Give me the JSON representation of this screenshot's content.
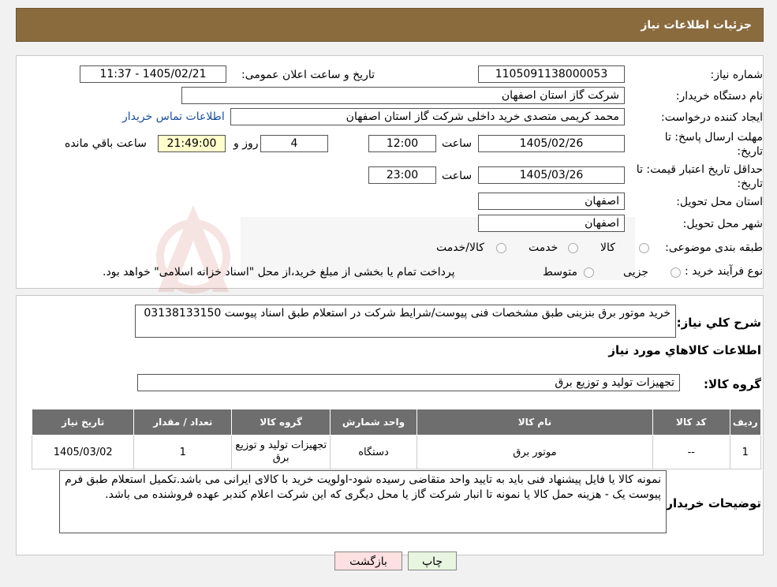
{
  "header": {
    "title": "جزئیات اطلاعات نیاز"
  },
  "form": {
    "need_number_label": "شماره نیاز:",
    "need_number": "1105091138000053",
    "announce_label": "تاریخ و ساعت اعلان عمومی:",
    "announce_value": "1405/02/21 - 11:37",
    "buyer_org_label": "نام دستگاه خریدار:",
    "buyer_org": "شرکت گاز استان اصفهان",
    "creator_label": "ایجاد کننده درخواست:",
    "creator": "محمد کریمی متصدی خرید داخلی شرکت گاز استان اصفهان",
    "contact_link": "اطلاعات تماس خریدار",
    "reply_deadline_label_1": "مهلت ارسال پاسخ: تا",
    "reply_deadline_label_2": "تاریخ:",
    "reply_date": "1405/02/26",
    "time_label": "ساعت",
    "reply_time": "12:00",
    "days_value": "4",
    "days_label": "روز و",
    "remaining_time": "21:49:00",
    "remaining_label": "ساعت باقي مانده",
    "validity_label_1": "حداقل تاریخ اعتبار قیمت: تا",
    "validity_label_2": "تاریخ:",
    "validity_date": "1405/03/26",
    "validity_time": "23:00",
    "province_label": "استان محل تحویل:",
    "province": "اصفهان",
    "city_label": "شهر محل تحویل:",
    "city": "اصفهان",
    "category_label": "طبقه بندی موضوعی:",
    "category_options": [
      "کالا",
      "خدمت",
      "کالا/خدمت"
    ],
    "process_label": "نوع فرآیند خرید :",
    "process_options": [
      "جزیی",
      "متوسط"
    ],
    "process_note": "پرداخت تمام یا بخشی از مبلغ خرید،از محل \"اسناد خزانه اسلامی\" خواهد بود."
  },
  "summary": {
    "desc_label": "شرح کلي نياز:",
    "desc_text": "خرید موتور برق بنزینی  طبق مشخصات فنی پیوست/شرایط شرکت در استعلام طبق اسناد پیوست 03138133150",
    "items_title": "اطلاعات کالاهاي مورد نياز",
    "group_label": "گروه کالا:",
    "group_value": "تجهیزات تولید و توزیع برق"
  },
  "table": {
    "headers": [
      "رديف",
      "کد کالا",
      "نام کالا",
      "واحد شمارش",
      "گروه کالا",
      "تعداد / مقدار",
      "تاريخ نياز"
    ],
    "rows": [
      [
        "1",
        "--",
        "موتور برق",
        "دستگاه",
        "تجهیزات تولید و توزیع برق",
        "1",
        "1405/03/02"
      ]
    ]
  },
  "notes": {
    "label": "توضیحات خریدار:",
    "text": "نمونه کالا یا فایل پیشنهاد فنی باید به تایید واحد متقاضی رسیده شود-اولویت خرید با کالای ایرانی می باشد.تکمیل استعلام طبق فرم پیوست یک - هزینه حمل کالا یا نمونه تا انبار شرکت گاز  یا محل دیگری که این شرکت اعلام کندبر عهده فروشنده می باشد."
  },
  "buttons": {
    "print": "چاپ",
    "back": "بازگشت"
  },
  "colors": {
    "header": "#8a6b3e",
    "table_header": "#6e6e6e",
    "back_button": "#fde0e0",
    "print_button": "#e8f5e0"
  }
}
